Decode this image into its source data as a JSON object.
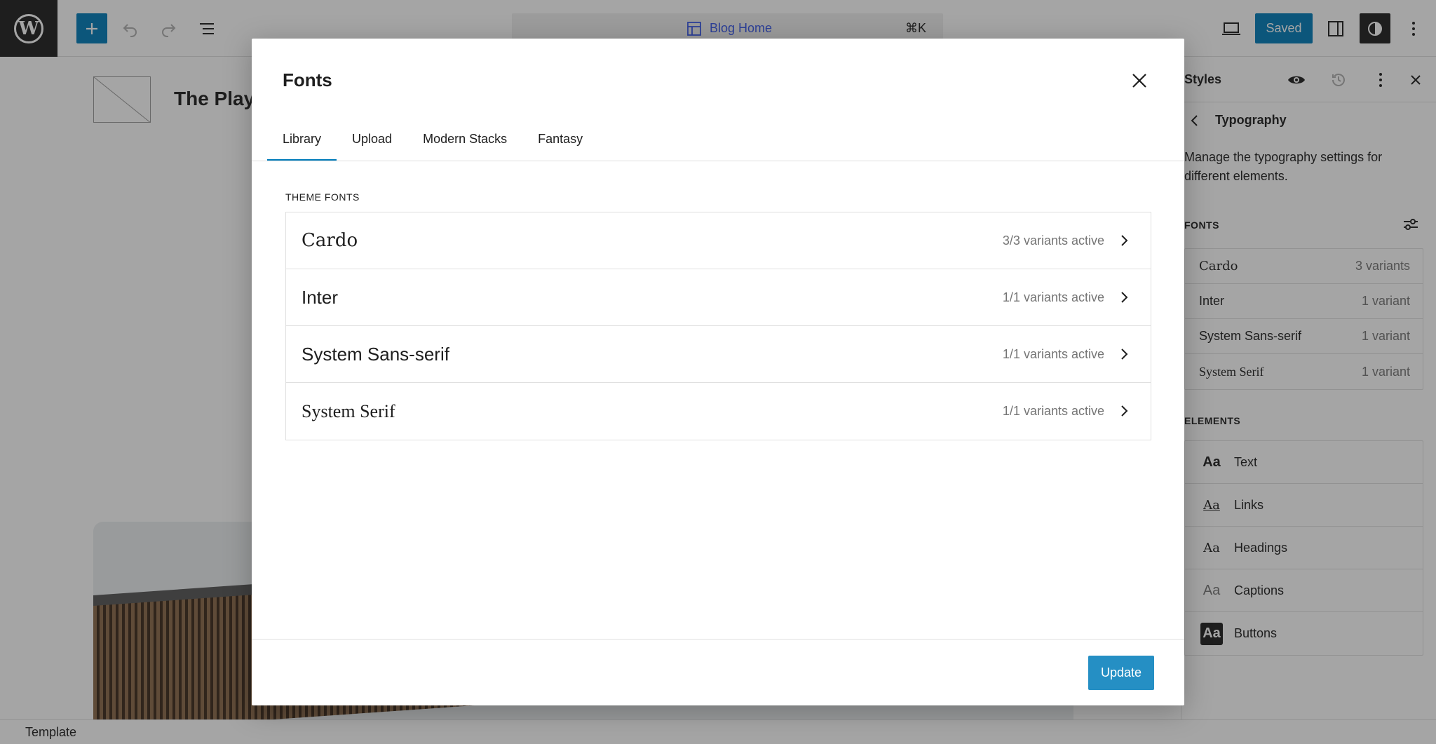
{
  "toolbar": {
    "add_icon": "plus-icon",
    "undo_icon": "undo-icon",
    "redo_icon": "redo-icon",
    "list_view_icon": "list-view-icon",
    "command": {
      "title": "Blog Home",
      "shortcut": "⌘K"
    },
    "saved_label": "Saved",
    "accent": "#007cba"
  },
  "canvas": {
    "site_title": "The Playg"
  },
  "sidebar": {
    "title": "Styles",
    "subheader": "Typography",
    "description": "Manage the typography settings for different elements.",
    "fonts_heading": "FONTS",
    "fonts": [
      {
        "name": "Cardo",
        "variants": "3 variants"
      },
      {
        "name": "Inter",
        "variants": "1 variant"
      },
      {
        "name": "System Sans-serif",
        "variants": "1 variant"
      },
      {
        "name": "System Serif",
        "variants": "1 variant"
      }
    ],
    "elements_heading": "ELEMENTS",
    "elements": [
      {
        "label": "Text",
        "glyph": "Aa"
      },
      {
        "label": "Links",
        "glyph": "Aa"
      },
      {
        "label": "Headings",
        "glyph": "Aa"
      },
      {
        "label": "Captions",
        "glyph": "Aa"
      },
      {
        "label": "Buttons",
        "glyph": "Aa"
      }
    ]
  },
  "statusbar": {
    "label": "Template"
  },
  "modal": {
    "title": "Fonts",
    "tabs": [
      {
        "label": "Library",
        "active": true
      },
      {
        "label": "Upload"
      },
      {
        "label": "Modern Stacks"
      },
      {
        "label": "Fantasy"
      }
    ],
    "section_label": "THEME FONTS",
    "fonts": [
      {
        "name": "Cardo",
        "status": "3/3 variants active"
      },
      {
        "name": "Inter",
        "status": "1/1 variants active"
      },
      {
        "name": "System Sans-serif",
        "status": "1/1 variants active"
      },
      {
        "name": "System Serif",
        "status": "1/1 variants active"
      }
    ],
    "update_label": "Update"
  }
}
